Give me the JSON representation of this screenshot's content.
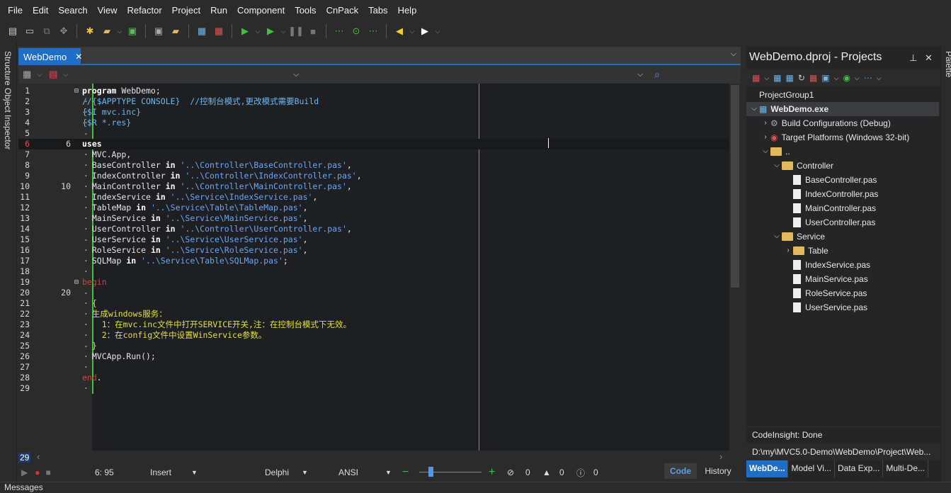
{
  "menu": [
    "File",
    "Edit",
    "Search",
    "View",
    "Refactor",
    "Project",
    "Run",
    "Component",
    "Tools",
    "CnPack",
    "Tabs",
    "Help"
  ],
  "left_panel_label": "Structure Object Inspector",
  "right_strip_label": "Palette",
  "editor": {
    "tab_label": "WebDemo",
    "tab_close": "✕",
    "lines": [
      {
        "n": "1",
        "mid": "",
        "parts": [
          [
            "kw",
            "program "
          ],
          [
            "pl",
            "WebDemo;"
          ]
        ],
        "fold": "⊟"
      },
      {
        "n": "2",
        "mid": "",
        "parts": [
          [
            "cm",
            "//{$APPTYPE CONSOLE}  //控制台模式,更改模式需要Build"
          ]
        ]
      },
      {
        "n": "3",
        "mid": "",
        "parts": [
          [
            "cm",
            "{$I mvc.inc}"
          ]
        ]
      },
      {
        "n": "4",
        "mid": "",
        "parts": [
          [
            "cm",
            "{$R *.res}"
          ]
        ]
      },
      {
        "n": "5",
        "mid": "",
        "parts": []
      },
      {
        "n": "6",
        "mid": "6",
        "parts": [
          [
            "kw",
            "uses"
          ]
        ],
        "current": true
      },
      {
        "n": "7",
        "mid": "",
        "parts": [
          [
            "pl",
            "  MVC.App,"
          ]
        ]
      },
      {
        "n": "8",
        "mid": "",
        "parts": [
          [
            "pl",
            "  BaseController "
          ],
          [
            "kw",
            "in "
          ],
          [
            "str",
            "'..\\Controller\\BaseController.pas'"
          ],
          [
            "pl",
            ","
          ]
        ]
      },
      {
        "n": "9",
        "mid": "",
        "parts": [
          [
            "pl",
            "  IndexController "
          ],
          [
            "kw",
            "in "
          ],
          [
            "str",
            "'..\\Controller\\IndexController.pas'"
          ],
          [
            "pl",
            ","
          ]
        ]
      },
      {
        "n": "10",
        "mid": "10",
        "parts": [
          [
            "pl",
            "  MainController "
          ],
          [
            "kw",
            "in "
          ],
          [
            "str",
            "'..\\Controller\\MainController.pas'"
          ],
          [
            "pl",
            ","
          ]
        ]
      },
      {
        "n": "11",
        "mid": "",
        "parts": [
          [
            "pl",
            "  IndexService "
          ],
          [
            "kw",
            "in "
          ],
          [
            "str",
            "'..\\Service\\IndexService.pas'"
          ],
          [
            "pl",
            ","
          ]
        ]
      },
      {
        "n": "12",
        "mid": "",
        "parts": [
          [
            "pl",
            "  TableMap "
          ],
          [
            "kw",
            "in "
          ],
          [
            "str",
            "'..\\Service\\Table\\TableMap.pas'"
          ],
          [
            "pl",
            ","
          ]
        ]
      },
      {
        "n": "13",
        "mid": "",
        "parts": [
          [
            "pl",
            "  MainService "
          ],
          [
            "kw",
            "in "
          ],
          [
            "str",
            "'..\\Service\\MainService.pas'"
          ],
          [
            "pl",
            ","
          ]
        ]
      },
      {
        "n": "14",
        "mid": "",
        "parts": [
          [
            "pl",
            "  UserController "
          ],
          [
            "kw",
            "in "
          ],
          [
            "str",
            "'..\\Controller\\UserController.pas'"
          ],
          [
            "pl",
            ","
          ]
        ]
      },
      {
        "n": "15",
        "mid": "",
        "parts": [
          [
            "pl",
            "  UserService "
          ],
          [
            "kw",
            "in "
          ],
          [
            "str",
            "'..\\Service\\UserService.pas'"
          ],
          [
            "pl",
            ","
          ]
        ]
      },
      {
        "n": "16",
        "mid": "",
        "parts": [
          [
            "pl",
            "  RoleService "
          ],
          [
            "kw",
            "in "
          ],
          [
            "str",
            "'..\\Service\\RoleService.pas'"
          ],
          [
            "pl",
            ","
          ]
        ]
      },
      {
        "n": "17",
        "mid": "",
        "parts": [
          [
            "pl",
            "  SQLMap "
          ],
          [
            "kw",
            "in "
          ],
          [
            "str",
            "'..\\Service\\Table\\SQLMap.pas'"
          ],
          [
            "pl",
            ";"
          ]
        ]
      },
      {
        "n": "18",
        "mid": "",
        "parts": []
      },
      {
        "n": "19",
        "mid": "",
        "parts": [
          [
            "rd",
            "begin"
          ]
        ],
        "fold": "⊟"
      },
      {
        "n": "20",
        "mid": "20",
        "parts": []
      },
      {
        "n": "21",
        "mid": "",
        "parts": [
          [
            "cn",
            "  {"
          ]
        ]
      },
      {
        "n": "22",
        "mid": "",
        "parts": [
          [
            "cn",
            "  生成windows服务："
          ]
        ]
      },
      {
        "n": "23",
        "mid": "",
        "parts": [
          [
            "cn",
            "    1：在mvc.inc文件中打开SERVICE开关,注：在控制台模式下无效。"
          ]
        ]
      },
      {
        "n": "24",
        "mid": "",
        "parts": [
          [
            "cn",
            "    2：在config文件中设置WinService参数。"
          ]
        ]
      },
      {
        "n": "25",
        "mid": "",
        "parts": [
          [
            "cn",
            "  }"
          ]
        ]
      },
      {
        "n": "26",
        "mid": "",
        "parts": [
          [
            "pl",
            "  MVCApp.Run();"
          ]
        ]
      },
      {
        "n": "27",
        "mid": "",
        "parts": []
      },
      {
        "n": "28",
        "mid": "",
        "parts": [
          [
            "rd",
            "end"
          ],
          [
            "pl",
            "."
          ]
        ]
      },
      {
        "n": "29",
        "mid": "",
        "parts": []
      }
    ],
    "bottom_line_num": "29"
  },
  "status": {
    "position": "6: 95",
    "mode": "Insert",
    "language": "Delphi",
    "encoding": "ANSI",
    "errors": "0",
    "warnings": "0",
    "hints": "0",
    "code_tab": "Code",
    "history_tab": "History"
  },
  "messages_label": "Messages",
  "projects": {
    "title": "WebDemo.dproj - Projects",
    "tree": [
      {
        "label": "ProjectGroup1",
        "indent": 0,
        "icon": "group",
        "chev": ""
      },
      {
        "label": "WebDemo.exe",
        "indent": 0,
        "icon": "exe",
        "chev": "⌵",
        "bold": true
      },
      {
        "label": "Build Configurations (Debug)",
        "indent": 1,
        "icon": "gear",
        "chev": "›"
      },
      {
        "label": "Target Platforms (Windows 32-bit)",
        "indent": 1,
        "icon": "target",
        "chev": "›"
      },
      {
        "label": "..",
        "indent": 1,
        "icon": "folder",
        "chev": "⌵"
      },
      {
        "label": "Controller",
        "indent": 2,
        "icon": "folder",
        "chev": "⌵"
      },
      {
        "label": "BaseController.pas",
        "indent": 3,
        "icon": "file",
        "chev": ""
      },
      {
        "label": "IndexController.pas",
        "indent": 3,
        "icon": "file",
        "chev": ""
      },
      {
        "label": "MainController.pas",
        "indent": 3,
        "icon": "file",
        "chev": ""
      },
      {
        "label": "UserController.pas",
        "indent": 3,
        "icon": "file",
        "chev": ""
      },
      {
        "label": "Service",
        "indent": 2,
        "icon": "folder",
        "chev": "⌵"
      },
      {
        "label": "Table",
        "indent": 3,
        "icon": "folder",
        "chev": "›"
      },
      {
        "label": "IndexService.pas",
        "indent": 3,
        "icon": "file",
        "chev": ""
      },
      {
        "label": "MainService.pas",
        "indent": 3,
        "icon": "file",
        "chev": ""
      },
      {
        "label": "RoleService.pas",
        "indent": 3,
        "icon": "file",
        "chev": ""
      },
      {
        "label": "UserService.pas",
        "indent": 3,
        "icon": "file",
        "chev": ""
      }
    ],
    "status": "CodeInsight: Done",
    "path": "D:\\my\\MVC5.0-Demo\\WebDemo\\Project\\Web...",
    "tabs": [
      "WebDe...",
      "Model Vi...",
      "Data Exp...",
      "Multi-De..."
    ]
  },
  "colors": {
    "accent": "#1e6ec7",
    "gutter_change": "#3cc43c",
    "keyword": "#ffffff",
    "string": "#6aa6f8",
    "comment": "#e0e040",
    "directive": "#6cb8f0",
    "begin_end": "#d04040"
  }
}
